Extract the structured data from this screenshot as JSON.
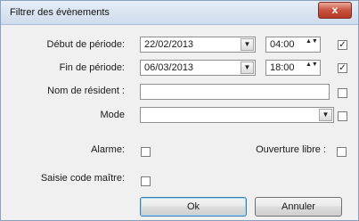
{
  "window": {
    "title": "Filtrer des évènements",
    "close_label": "x"
  },
  "form": {
    "debut": {
      "label": "Début de période:",
      "date": "22/02/2013",
      "time": "04:00",
      "checked": true
    },
    "fin": {
      "label": "Fin de période:",
      "date": "06/03/2013",
      "time": "18:00",
      "checked": true
    },
    "nom_resident": {
      "label": "Nom de résident :",
      "value": "",
      "checked": false
    },
    "mode": {
      "label": "Mode",
      "value": "",
      "checked": false
    },
    "alarme": {
      "label": "Alarme:",
      "checked": false
    },
    "ouverture_libre": {
      "label": "Ouverture libre :",
      "checked": false
    },
    "saisie_code_maitre": {
      "label": "Saisie code maître:",
      "checked": false
    }
  },
  "buttons": {
    "ok": "Ok",
    "annuler": "Annuler"
  },
  "glyphs": {
    "dropdown": "▼",
    "spin": "▲▼",
    "check": "✓"
  }
}
